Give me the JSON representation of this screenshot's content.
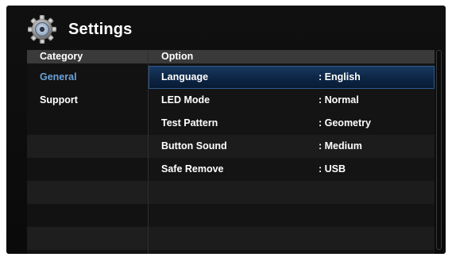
{
  "header": {
    "title": "Settings",
    "icon": "gear-icon"
  },
  "table": {
    "category_header": "Category",
    "option_header": "Option",
    "categories": [
      {
        "label": "General",
        "active": true
      },
      {
        "label": "Support",
        "active": false
      }
    ],
    "options": [
      {
        "name": "Language",
        "value": ": English",
        "selected": true
      },
      {
        "name": "LED Mode",
        "value": ": Normal",
        "selected": false
      },
      {
        "name": "Test Pattern",
        "value": ": Geometry",
        "selected": false
      },
      {
        "name": "Button Sound",
        "value": ": Medium",
        "selected": false
      },
      {
        "name": "Safe Remove",
        "value": ": USB",
        "selected": false
      }
    ]
  },
  "colors": {
    "accent": "#6aa2d8",
    "selection": "#0e2848",
    "background": "#0a0a0a"
  }
}
